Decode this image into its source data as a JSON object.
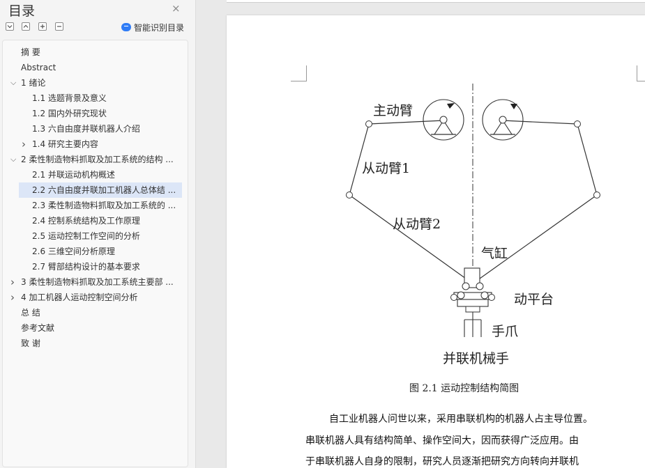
{
  "sidebar": {
    "title": "目录",
    "close_symbol": "×",
    "tools": [
      "collapse-all",
      "expand-all",
      "add",
      "remove"
    ],
    "smart_label": "智能识别目录",
    "items": [
      {
        "label": "摘    要",
        "level": 0,
        "chevron": "",
        "selected": false
      },
      {
        "label": "Abstract",
        "level": 0,
        "chevron": "",
        "selected": false
      },
      {
        "label": "1  绪论",
        "level": 0,
        "chevron": "down",
        "selected": false
      },
      {
        "label": "1.1  选题背景及意义",
        "level": 1,
        "chevron": "",
        "selected": false
      },
      {
        "label": "1.2  国内外研究现状",
        "level": 1,
        "chevron": "",
        "selected": false
      },
      {
        "label": "1.3 六自由度并联机器人介绍",
        "level": 1,
        "chevron": "",
        "selected": false
      },
      {
        "label": "1.4 研究主要内容",
        "level": 1,
        "chevron": "right",
        "selected": false
      },
      {
        "label": "2 柔性制造物料抓取及加工系统的结构 ...",
        "level": 0,
        "chevron": "down",
        "selected": false
      },
      {
        "label": "2.1  并联运动机构概述",
        "level": 1,
        "chevron": "",
        "selected": false
      },
      {
        "label": "2.2  六自由度并联加工机器人总体结 ...",
        "level": 1,
        "chevron": "",
        "selected": true
      },
      {
        "label": "2.3 柔性制造物料抓取及加工系统的 ...",
        "level": 1,
        "chevron": "",
        "selected": false
      },
      {
        "label": "2.4  控制系统结构及工作原理",
        "level": 1,
        "chevron": "",
        "selected": false
      },
      {
        "label": "2.5  运动控制工作空间的分析",
        "level": 1,
        "chevron": "",
        "selected": false
      },
      {
        "label": "2.6 三维空间分析原理",
        "level": 1,
        "chevron": "",
        "selected": false
      },
      {
        "label": "2.7 臂部结构设计的基本要求",
        "level": 1,
        "chevron": "",
        "selected": false
      },
      {
        "label": "3  柔性制造物料抓取及加工系统主要部 ...",
        "level": 0,
        "chevron": "right",
        "selected": false
      },
      {
        "label": "4  加工机器人运动控制空间分析",
        "level": 0,
        "chevron": "right",
        "selected": false
      },
      {
        "label": "总    结",
        "level": 0,
        "chevron": "",
        "selected": false
      },
      {
        "label": "参考文献",
        "level": 0,
        "chevron": "",
        "selected": false
      },
      {
        "label": "致    谢",
        "level": 0,
        "chevron": "",
        "selected": false
      }
    ]
  },
  "document": {
    "figure": {
      "labels": {
        "main_arm": "主动臂",
        "follower_arm_1": "从动臂1",
        "follower_arm_2": "从动臂2",
        "cylinder": "气缸",
        "moving_platform": "动平台",
        "gripper": "手爪",
        "parallel_manipulator": "并联机械手"
      },
      "caption": "图 2.1  运动控制结构简图"
    },
    "paragraph_lines": [
      "自工业机器人问世以来，采用串联机构的机器人占主导位置。",
      "串联机器人具有结构简单、操作空间大，因而获得广泛应用。由",
      "于串联机器人自身的限制，研究人员逐渐把研究方向转向并联机"
    ]
  },
  "colors": {
    "selected_bg": "#dce6f7",
    "accent": "#2f7cf6"
  }
}
